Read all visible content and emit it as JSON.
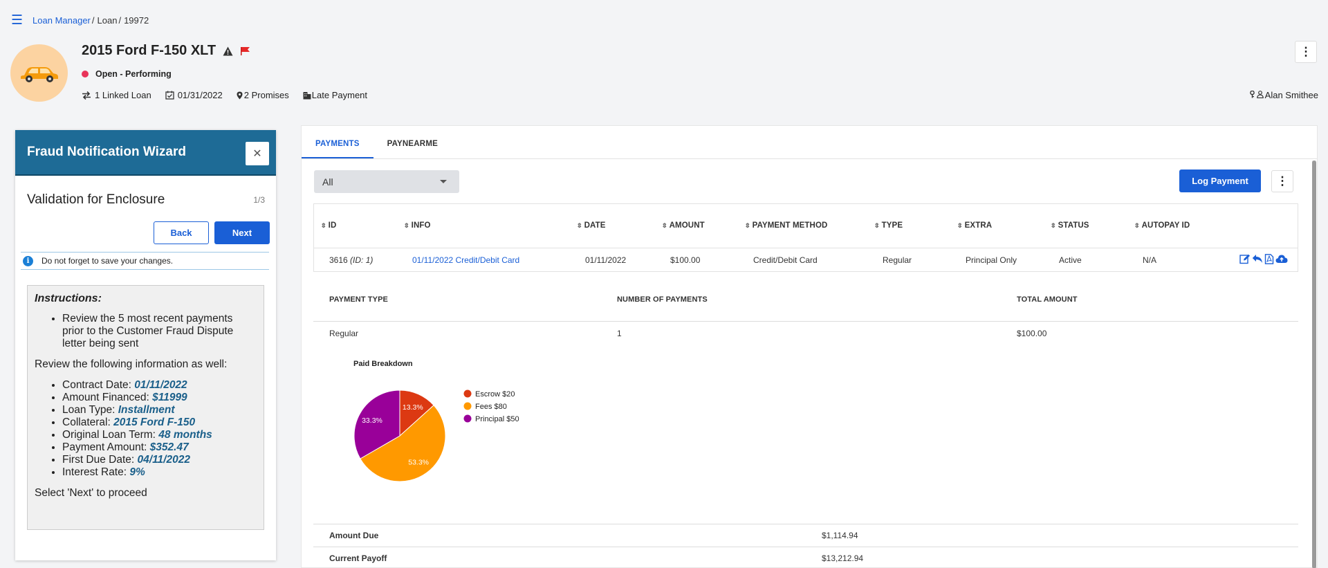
{
  "breadcrumb": {
    "root": "Loan Manager",
    "section": "Loan",
    "id": "19972"
  },
  "header": {
    "title": "2015 Ford F-150 XLT",
    "status": "Open - Performing",
    "linked_loans": "1 Linked Loan",
    "date": "01/31/2022",
    "promises": "2 Promises",
    "late_payment": "Late Payment",
    "owner": "Alan Smithee"
  },
  "wizard": {
    "title": "Fraud Notification Wizard",
    "step_title": "Validation for Enclosure",
    "step_count": "1/3",
    "back_label": "Back",
    "next_label": "Next",
    "notice": "Do not forget to save your changes.",
    "instructions_heading": "Instructions:",
    "bullet_1": "Review the 5 most recent payments prior to the Customer Fraud Dispute letter being sent",
    "review_text": "Review the following information as well:",
    "details": [
      {
        "label": "Contract Date: ",
        "value": "01/11/2022"
      },
      {
        "label": "Amount Financed: ",
        "value": "$11999"
      },
      {
        "label": "Loan Type: ",
        "value": "Installment"
      },
      {
        "label": "Collateral: ",
        "value": "2015 Ford F-150"
      },
      {
        "label": "Original Loan Term: ",
        "value": "48 months"
      },
      {
        "label": "Payment Amount: ",
        "value": "$352.47"
      },
      {
        "label": "First Due Date: ",
        "value": "04/11/2022"
      },
      {
        "label": "Interest Rate: ",
        "value": "9%"
      }
    ],
    "proceed_text": "Select 'Next' to proceed"
  },
  "tabs": [
    "PAYMENTS",
    "PAYNEARME"
  ],
  "filter": {
    "selected": "All"
  },
  "log_payment_label": "Log Payment",
  "table": {
    "headers": [
      "ID",
      "INFO",
      "DATE",
      "AMOUNT",
      "PAYMENT METHOD",
      "TYPE",
      "EXTRA",
      "STATUS",
      "AUTOPAY ID"
    ],
    "row": {
      "id": "3616",
      "id_sub": "(ID: 1)",
      "info": "01/11/2022 Credit/Debit Card",
      "date": "01/11/2022",
      "amount": "$100.00",
      "method": "Credit/Debit Card",
      "type": "Regular",
      "extra": "Principal Only",
      "status": "Active",
      "autopay": "N/A"
    }
  },
  "summary": {
    "headers": [
      "PAYMENT TYPE",
      "NUMBER OF PAYMENTS",
      "TOTAL AMOUNT"
    ],
    "row": {
      "type": "Regular",
      "count": "1",
      "total": "$100.00"
    }
  },
  "chart_data": {
    "type": "pie",
    "title": "Paid Breakdown",
    "labels": [
      "Escrow $20",
      "Fees $80",
      "Principal $50"
    ],
    "values": [
      20,
      80,
      50
    ],
    "percent_labels": [
      "13.3%",
      "53.3%",
      "33.3%"
    ],
    "colors": [
      "#dc3912",
      "#ff9900",
      "#990099"
    ],
    "legend": "right"
  },
  "totals": [
    {
      "label": "Amount Due",
      "value": "$1,114.94"
    },
    {
      "label": "Current Payoff",
      "value": "$13,212.94"
    }
  ]
}
